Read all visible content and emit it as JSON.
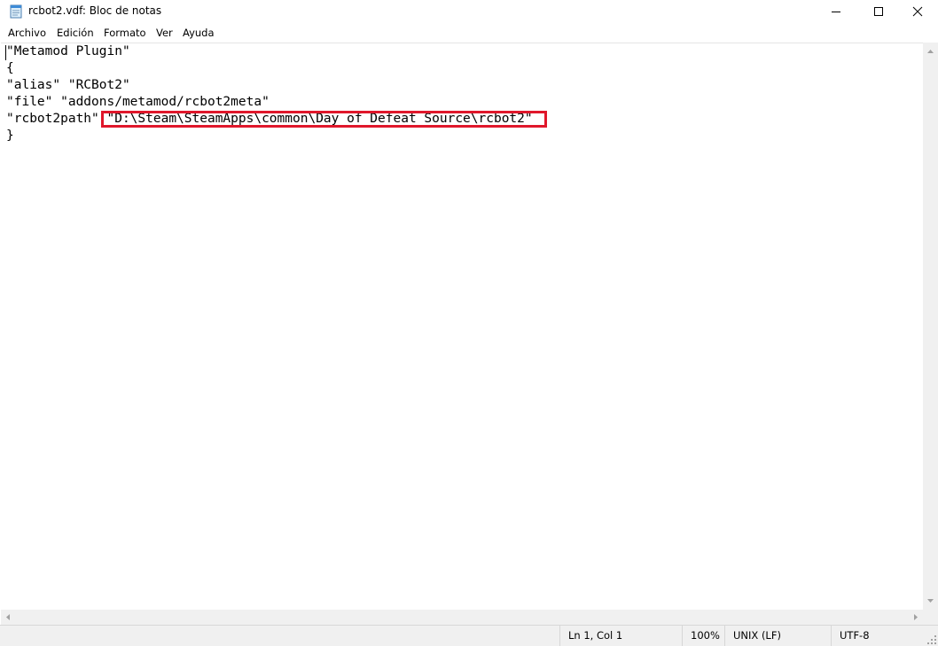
{
  "window": {
    "title": "rcbot2.vdf: Bloc de notas",
    "app_icon": "notepad-icon",
    "controls": [
      "minimize-icon",
      "maximize-icon",
      "close-icon"
    ]
  },
  "menu": {
    "items": [
      "Archivo",
      "Edición",
      "Formato",
      "Ver",
      "Ayuda"
    ]
  },
  "editor": {
    "lines": [
      "\"Metamod Plugin\"",
      "{",
      "\"alias\" \"RCBot2\"",
      "\"file\" \"addons/metamod/rcbot2meta\"",
      "\"rcbot2path\" \"D:\\Steam\\SteamApps\\common\\Day of Defeat Source\\rcbot2\"",
      "}"
    ],
    "highlight_color": "#e0172b"
  },
  "status": {
    "position": "Ln 1, Col 1",
    "zoom": "100%",
    "line_ending": "UNIX (LF)",
    "encoding": "UTF-8"
  }
}
